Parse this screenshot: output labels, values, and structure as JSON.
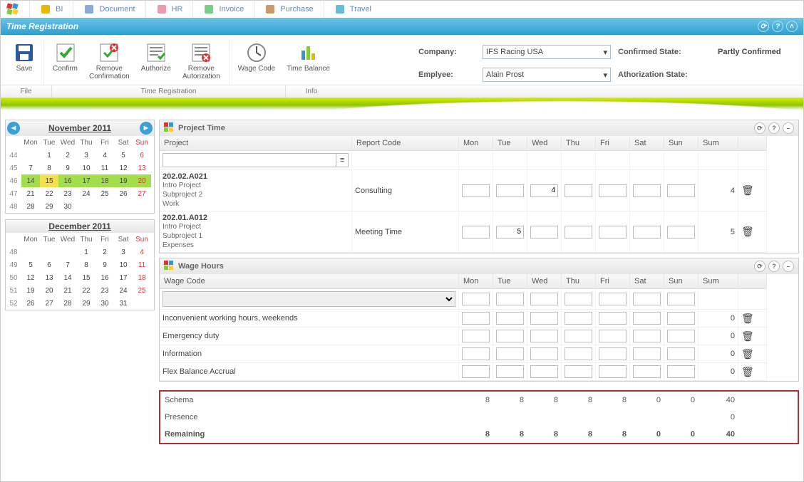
{
  "topnav": [
    {
      "icon": "key",
      "label": "BI"
    },
    {
      "icon": "doc",
      "label": "Document"
    },
    {
      "icon": "hr",
      "label": "HR"
    },
    {
      "icon": "inv",
      "label": "Invoice"
    },
    {
      "icon": "pur",
      "label": "Purchase"
    },
    {
      "icon": "trv",
      "label": "Travel"
    }
  ],
  "titlebar": {
    "title": "Time Registration"
  },
  "ribbon": {
    "buttons": [
      {
        "id": "save",
        "label": "Save"
      },
      {
        "id": "confirm",
        "label": "Confirm"
      },
      {
        "id": "remove-confirmation",
        "label": "Remove\nConfirmation"
      },
      {
        "id": "authorize",
        "label": "Authorize"
      },
      {
        "id": "remove-authorization",
        "label": "Remove\nAutorization"
      },
      {
        "id": "wage-code",
        "label": "Wage Code"
      },
      {
        "id": "time-balance",
        "label": "Time Balance"
      }
    ],
    "groups": [
      "File",
      "Time Registration",
      "Info"
    ],
    "company_label": "Company:",
    "employee_label": "Emplyee:",
    "company_value": "IFS Racing USA",
    "employee_value": "Alain Prost",
    "confirmed_state_label": "Confirmed State:",
    "authorization_state_label": "Athorization State:",
    "confirmed_state_value": "Partly Confirmed",
    "authorization_state_value": ""
  },
  "calendars": [
    {
      "title": "November 2011",
      "dayhead": [
        "Mon",
        "Tue",
        "Wed",
        "Thu",
        "Fri",
        "Sat",
        "Sun"
      ],
      "rows": [
        {
          "wk": "44",
          "days": [
            "",
            "1",
            "2",
            "3",
            "4",
            "5",
            "6"
          ],
          "sun": 6
        },
        {
          "wk": "45",
          "days": [
            "7",
            "8",
            "9",
            "10",
            "11",
            "12",
            "13"
          ],
          "sun": 6
        },
        {
          "wk": "46",
          "days": [
            "14",
            "15",
            "16",
            "17",
            "18",
            "19",
            "20"
          ],
          "sun": 6,
          "hl": [
            0,
            1,
            2,
            3,
            4,
            5,
            6
          ],
          "sel": 1
        },
        {
          "wk": "47",
          "days": [
            "21",
            "22",
            "23",
            "24",
            "25",
            "26",
            "27"
          ],
          "sun": 6
        },
        {
          "wk": "48",
          "days": [
            "28",
            "29",
            "30",
            "",
            "",
            "",
            ""
          ]
        }
      ]
    },
    {
      "title": "December 2011",
      "dayhead": [
        "Mon",
        "Tue",
        "Wed",
        "Thu",
        "Fri",
        "Sat",
        "Sun"
      ],
      "rows": [
        {
          "wk": "48",
          "days": [
            "",
            "",
            "",
            "1",
            "2",
            "3",
            "4"
          ],
          "sun": 6
        },
        {
          "wk": "49",
          "days": [
            "5",
            "6",
            "7",
            "8",
            "9",
            "10",
            "11"
          ],
          "sun": 6
        },
        {
          "wk": "50",
          "days": [
            "12",
            "13",
            "14",
            "15",
            "16",
            "17",
            "18"
          ],
          "sun": 6
        },
        {
          "wk": "51",
          "days": [
            "19",
            "20",
            "21",
            "22",
            "23",
            "24",
            "25"
          ],
          "sun": 6
        },
        {
          "wk": "52",
          "days": [
            "26",
            "27",
            "28",
            "29",
            "30",
            "31",
            ""
          ]
        }
      ]
    }
  ],
  "project_time": {
    "title": "Project Time",
    "cols": [
      "Project",
      "Report Code",
      "Mon",
      "Tue",
      "Wed",
      "Thu",
      "Fri",
      "Sat",
      "Sun",
      "Sum",
      ""
    ],
    "rows": [
      {
        "code": "202.02.A021",
        "lines": [
          "Intro Project",
          "Subproject 2",
          "Work"
        ],
        "report": "Consulting",
        "vals": [
          "",
          "",
          "4",
          "",
          "",
          "",
          ""
        ],
        "sum": "4"
      },
      {
        "code": "202.01.A012",
        "lines": [
          "Intro Project",
          "Subproject 1",
          "Expenses"
        ],
        "report": "Meeting Time",
        "vals": [
          "",
          "5",
          "",
          "",
          "",
          "",
          ""
        ],
        "sum": "5"
      }
    ]
  },
  "wage_hours": {
    "title": "Wage Hours",
    "cols": [
      "Wage Code",
      "Mon",
      "Tue",
      "Wed",
      "Thu",
      "Fri",
      "Sat",
      "Sun",
      "Sum",
      ""
    ],
    "rows": [
      {
        "label": "Inconvenient working hours, weekends",
        "sum": "0"
      },
      {
        "label": "Emergency duty",
        "sum": "0"
      },
      {
        "label": "Information",
        "sum": "0"
      },
      {
        "label": "Flex Balance Accrual",
        "sum": "0"
      }
    ]
  },
  "summary": {
    "rows": [
      {
        "label": "Schema",
        "vals": [
          "8",
          "8",
          "8",
          "8",
          "8",
          "0",
          "0"
        ],
        "sum": "40"
      },
      {
        "label": "Presence",
        "vals": [
          "",
          "",
          "",
          "",
          "",
          "",
          ""
        ],
        "sum": "0"
      },
      {
        "label": "Remaining",
        "vals": [
          "8",
          "8",
          "8",
          "8",
          "8",
          "0",
          "0"
        ],
        "sum": "40",
        "bold": true
      }
    ]
  }
}
